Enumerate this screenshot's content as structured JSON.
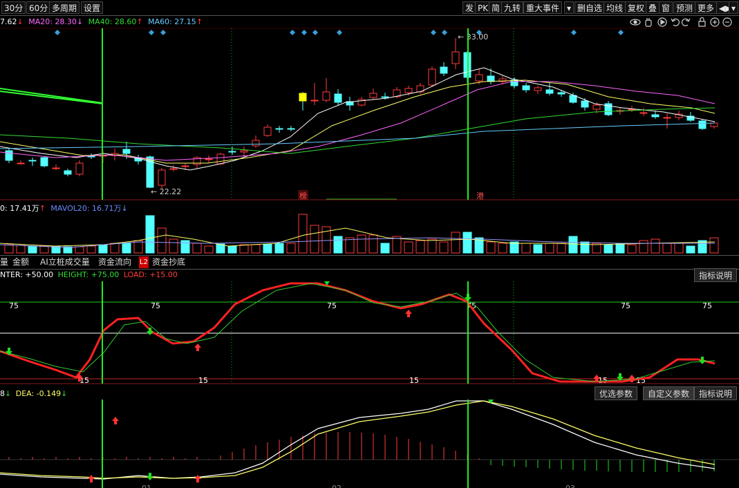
{
  "toolbar": {
    "left": [
      "30分",
      "60分",
      "多周期",
      "设置"
    ],
    "right": [
      "发",
      "PK",
      "简",
      "九转",
      "重大事件",
      "▾",
      "删自选",
      "均线",
      "复权",
      "叠",
      "窗",
      "预测",
      "更多",
      "◀▶",
      "▾"
    ]
  },
  "ma_legend": {
    "ma_partial": "7.62",
    "ma20": "MA20: 28.30",
    "ma40": "MA40: 28.60",
    "ma60": "MA60: 27.15",
    "arrow_down": "↓",
    "arrow_up": "↑"
  },
  "price_chart": {
    "high_label": "33.00",
    "low_label": "22.22",
    "tag_bang": "榜",
    "tag_gang": "港",
    "colors": {
      "up": "#ff3b3b",
      "down": "#54ffff",
      "ma5": "#ffffff",
      "ma10": "#ffff66",
      "ma20": "#ff66ff",
      "ma40": "#33dd33",
      "ma60": "#66ccff"
    }
  },
  "volume_legend": {
    "vol": "0: 17.41万",
    "mavol20": "MAVOL20: 16.71万",
    "arrow_up": "↑",
    "arrow_down": "↓"
  },
  "indicator_tabs": [
    "量",
    "金额",
    "AI立桩成交量",
    "资金流向",
    "L2",
    "资金抄底"
  ],
  "panel3": {
    "legend_center": "NTER: +50.00",
    "legend_height": "HEIGHT: +75.00",
    "legend_load": "LOAD: +15.00",
    "help_button": "指标说明",
    "labels_75": [
      "75",
      "75",
      "75",
      "75",
      "75",
      "75"
    ],
    "labels_15": [
      "15",
      "15",
      "15",
      "15",
      "15"
    ]
  },
  "panel4": {
    "legend_dif": "8",
    "legend_dea": "DEA: -0.149",
    "arrow": "↓",
    "btn_optimal": "优选参数",
    "btn_custom": "自定义参数",
    "btn_help": "指标说明",
    "axis_labels": [
      "01",
      "02",
      "03"
    ]
  },
  "right_icons": [
    "eye-icon",
    "hand-icon",
    "play-icon",
    "undo-icon",
    "redo-icon",
    "lock-icon",
    "zoom-in-icon",
    "zoom-out-icon"
  ]
}
